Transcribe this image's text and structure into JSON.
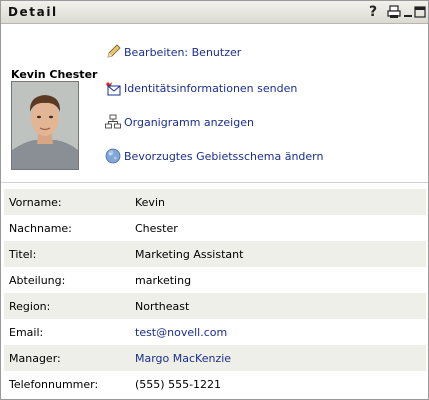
{
  "window": {
    "title": "Detail",
    "controls": {
      "help": "?"
    }
  },
  "profile": {
    "name": "Kevin Chester",
    "actions": [
      {
        "label": "Bearbeiten: Benutzer",
        "icon": "pencil-icon"
      },
      {
        "label": "Identitätsinformationen senden",
        "icon": "envelope-send-icon"
      },
      {
        "label": "Organigramm anzeigen",
        "icon": "org-chart-icon"
      },
      {
        "label": "Bevorzugtes Gebietsschema ändern",
        "icon": "globe-icon"
      }
    ]
  },
  "details": [
    {
      "label": "Vorname:",
      "value": "Kevin",
      "link": false
    },
    {
      "label": "Nachname:",
      "value": "Chester",
      "link": false
    },
    {
      "label": "Titel:",
      "value": "Marketing Assistant",
      "link": false
    },
    {
      "label": "Abteilung:",
      "value": "marketing",
      "link": false
    },
    {
      "label": "Region:",
      "value": "Northeast",
      "link": false
    },
    {
      "label": "Email:",
      "value": "test@novell.com",
      "link": true
    },
    {
      "label": "Manager:",
      "value": "Margo MacKenzie",
      "link": true
    },
    {
      "label": "Telefonnummer:",
      "value": "(555) 555-1221",
      "link": false
    }
  ],
  "colors": {
    "link": "#1a2f8c",
    "row_shade": "#efefe9",
    "titlebar": "#dcdad2"
  }
}
